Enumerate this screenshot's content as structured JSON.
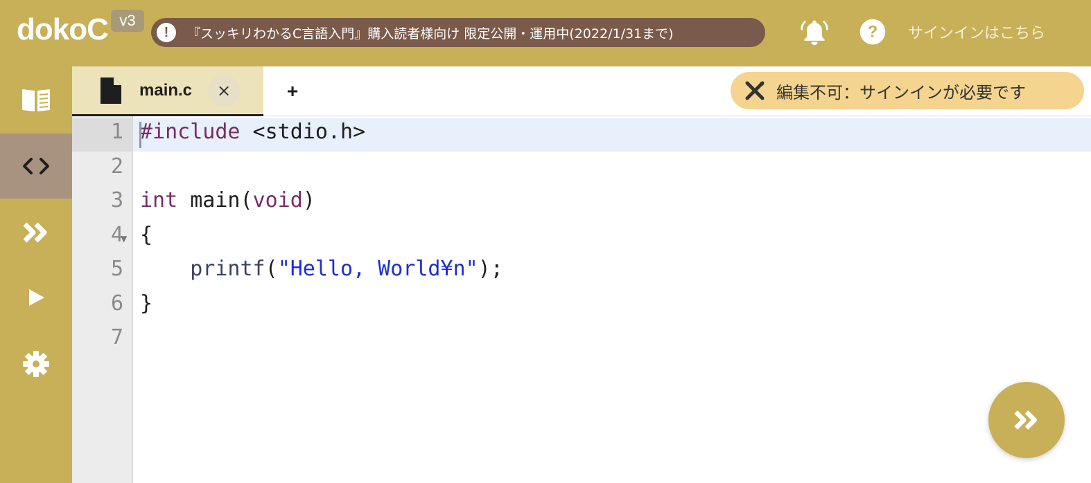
{
  "header": {
    "logo": "dokoC",
    "version": "v3",
    "notice_icon": "!",
    "notice_text": "『スッキリわかるC言語入門』購入読者様向け 限定公開・運用中(2022/1/31まで)",
    "bell_icon": "bell-icon",
    "help_icon": "help-icon",
    "signin_label": "サインインはこちら"
  },
  "sidebar": {
    "items": [
      {
        "name": "book",
        "icon": "book-icon"
      },
      {
        "name": "code",
        "icon": "code-icon",
        "active": true
      },
      {
        "name": "forward",
        "icon": "double-chevron-icon"
      },
      {
        "name": "run",
        "icon": "play-icon"
      },
      {
        "name": "settings",
        "icon": "gear-icon"
      }
    ]
  },
  "tabs": {
    "items": [
      {
        "label": "main.c",
        "close": "×",
        "active": true
      }
    ],
    "add_label": "+",
    "readonly_label": "編集不可：サインインが必要です"
  },
  "editor": {
    "line_numbers": [
      "1",
      "2",
      "3",
      "4",
      "5",
      "6",
      "7"
    ],
    "lines": [
      [
        {
          "t": "#include",
          "c": "kw"
        },
        {
          "t": " <stdio.h>",
          "c": ""
        }
      ],
      [],
      [
        {
          "t": "int",
          "c": "kw"
        },
        {
          "t": " main(",
          "c": ""
        },
        {
          "t": "void",
          "c": "kw"
        },
        {
          "t": ")",
          "c": ""
        }
      ],
      [
        {
          "t": "{",
          "c": ""
        }
      ],
      [
        {
          "t": "    ",
          "c": ""
        },
        {
          "t": "printf",
          "c": "fn"
        },
        {
          "t": "(",
          "c": ""
        },
        {
          "t": "\"Hello, World¥n\"",
          "c": "str"
        },
        {
          "t": ");",
          "c": ""
        }
      ],
      [
        {
          "t": "}",
          "c": ""
        }
      ],
      []
    ]
  },
  "colors": {
    "brand": "#c8b058",
    "notice_bg": "#7a5a4b",
    "active_tab_bg": "#ede3bb",
    "readonly_bg": "#f4d48e",
    "active_line_bg": "#e8f0fb",
    "keyword": "#7a2b68",
    "string": "#1d2dd6"
  }
}
